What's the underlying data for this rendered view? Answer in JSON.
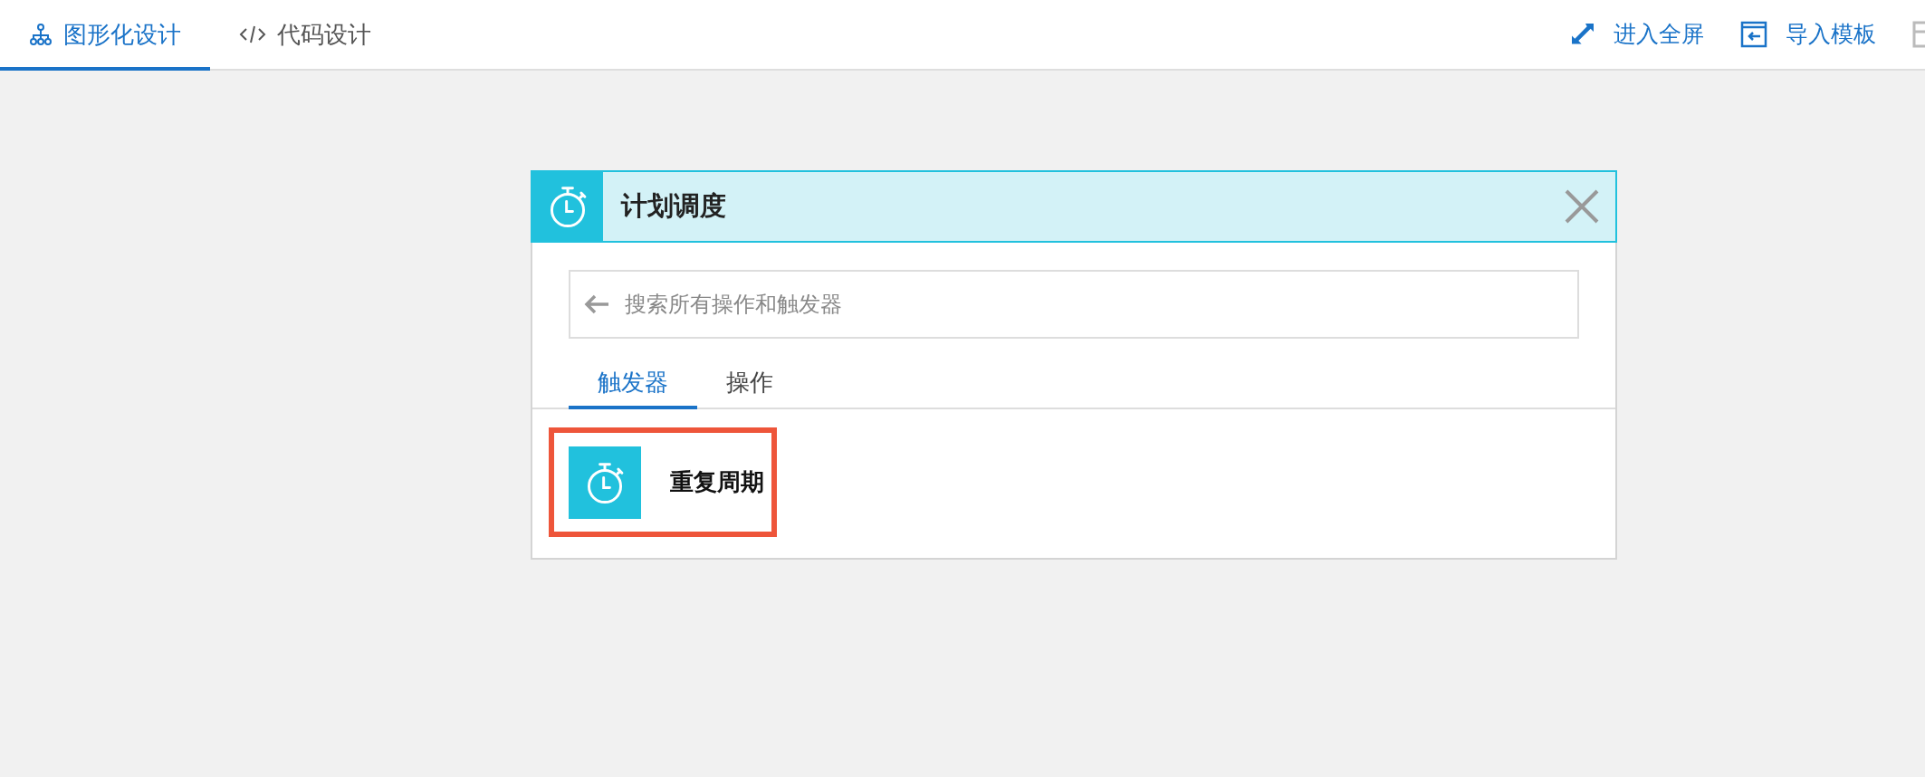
{
  "tabs": [
    {
      "label": "图形化设计",
      "kind": "graph",
      "selected": true
    },
    {
      "label": "代码设计",
      "kind": "code",
      "selected": false
    }
  ],
  "actions": [
    {
      "label": "进入全屏",
      "kind": "fullscreen"
    },
    {
      "label": "导入模板",
      "kind": "import"
    }
  ],
  "dialog": {
    "title": "计划调度",
    "search": {
      "placeholder": "搜索所有操作和触发器"
    },
    "tabs": [
      {
        "label": "触发器",
        "selected": true
      },
      {
        "label": "操作",
        "selected": false
      }
    ],
    "items": [
      {
        "label": "重复周期",
        "highlighted": true
      }
    ]
  }
}
